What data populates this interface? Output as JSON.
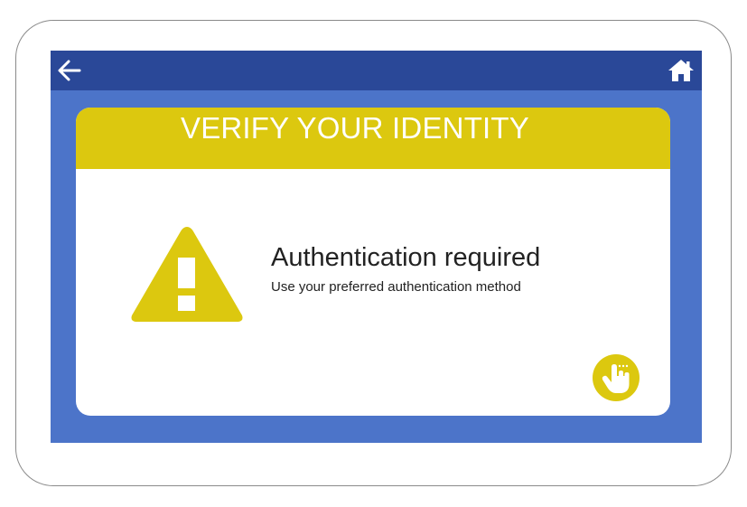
{
  "header": {
    "back_icon": "arrow-left-icon",
    "home_icon": "home-icon"
  },
  "card": {
    "title": "VERIFY YOUR IDENTITY",
    "message_title": "Authentication required",
    "message_subtitle": "Use your preferred authentication method",
    "warning_icon": "warning-triangle-icon",
    "action_icon": "hand-touch-icon"
  },
  "colors": {
    "device_border": "#8a8a8a",
    "screen_bg": "#4c74c9",
    "topbar_bg": "#2a4898",
    "accent_yellow": "#dcc80f",
    "card_bg": "#ffffff",
    "text_dark": "#222222"
  }
}
